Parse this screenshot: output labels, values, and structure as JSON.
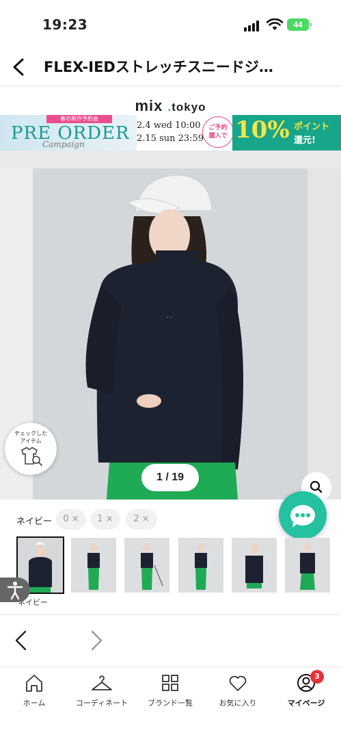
{
  "status_bar": {
    "time": "19:23",
    "battery": "44"
  },
  "header": {
    "title": "FLEX-IEDストレッチスニードジ…"
  },
  "brand": {
    "name": "mix",
    "dot": ".",
    "tld": "tokyo"
  },
  "banner": {
    "tag": "春の新作予約会",
    "title": "PRE ORDER",
    "script": "Campaign",
    "date_start": "2.4 wed 10:00 –",
    "date_end": "2.15 sun 23:59",
    "bubble": "ご予約\n購入で",
    "percent": "10%",
    "point_label": "ポイント",
    "cashback_label": "還元!",
    "colors": {
      "left_bg": "#cfe6f1",
      "right_bg": "#17a68a",
      "accent": "#e94e8f",
      "gold": "#f6e64a"
    }
  },
  "gallery": {
    "pager": "1 / 19",
    "current": 1,
    "total": 19,
    "checked_items_label": "チェックした\nアイテム",
    "colors": {
      "jacket": "#1d2230",
      "pants": "#1faa55",
      "cap": "#f3f3f3"
    }
  },
  "variants": {
    "color_label": "ネイビー",
    "sizes": [
      "0 ×",
      "1 ×",
      "2 ×"
    ]
  },
  "thumbnails": {
    "count": 6,
    "selected_index": 0,
    "caption": "ネイビー"
  },
  "tabbar": {
    "items": [
      {
        "label": "ホーム",
        "icon": "home-icon"
      },
      {
        "label": "コーディネート",
        "icon": "hanger-icon"
      },
      {
        "label": "ブランド一覧",
        "icon": "grid-icon"
      },
      {
        "label": "お気に入り",
        "icon": "heart-icon"
      },
      {
        "label": "マイページ",
        "icon": "user-icon",
        "badge": "3",
        "active": true
      }
    ]
  },
  "accent_color": "#24c2a0"
}
